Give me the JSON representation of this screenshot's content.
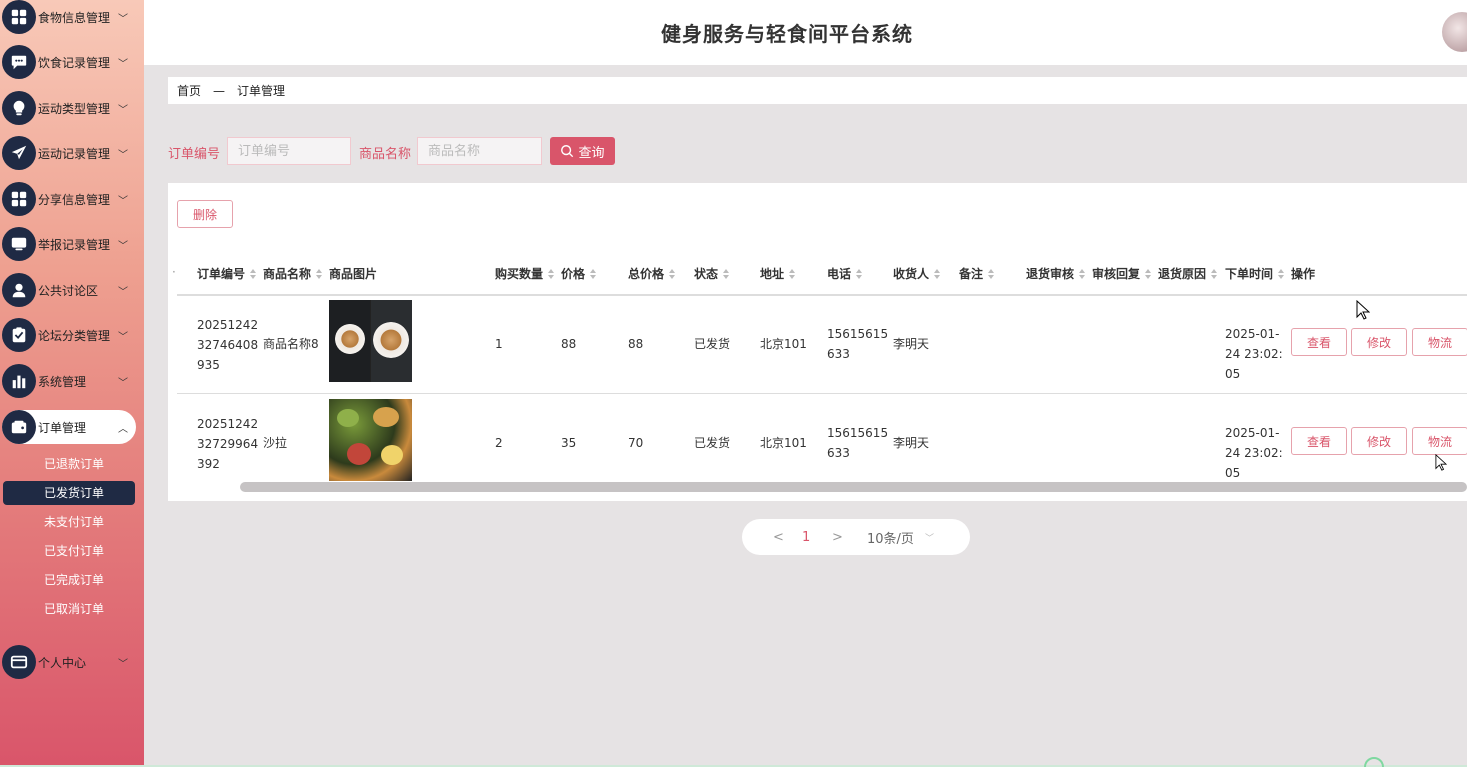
{
  "header": {
    "title": "健身服务与轻食间平台系统"
  },
  "sidebar": {
    "items": [
      {
        "label": "食物信息管理",
        "icon": "grid-icon"
      },
      {
        "label": "饮食记录管理",
        "icon": "chat-icon"
      },
      {
        "label": "运动类型管理",
        "icon": "bulb-icon"
      },
      {
        "label": "运动记录管理",
        "icon": "send-icon"
      },
      {
        "label": "分享信息管理",
        "icon": "grid-icon"
      },
      {
        "label": "举报记录管理",
        "icon": "monitor-icon"
      },
      {
        "label": "公共讨论区",
        "icon": "user-icon"
      },
      {
        "label": "论坛分类管理",
        "icon": "clipboard-icon"
      },
      {
        "label": "系统管理",
        "icon": "bar-chart-icon"
      },
      {
        "label": "订单管理",
        "icon": "wallet-icon"
      },
      {
        "label": "个人中心",
        "icon": "card-icon"
      }
    ],
    "order_sub": [
      "已退款订单",
      "已发货订单",
      "未支付订单",
      "已支付订单",
      "已完成订单",
      "已取消订单"
    ]
  },
  "breadcrumb": {
    "home": "首页",
    "sep": "—",
    "current": "订单管理"
  },
  "search": {
    "order_no_label": "订单编号",
    "order_no_placeholder": "订单编号",
    "product_label": "商品名称",
    "product_placeholder": "商品名称",
    "button": "查询"
  },
  "table": {
    "delete_button": "删除",
    "columns": [
      "订单编号",
      "商品名称",
      "商品图片",
      "购买数量",
      "价格",
      "总价格",
      "状态",
      "地址",
      "电话",
      "收货人",
      "备注",
      "退货审核",
      "审核回复",
      "退货原因",
      "下单时间",
      "操作"
    ],
    "rows": [
      {
        "order_no": "2025124232746408935",
        "product": "商品名称8",
        "qty": "1",
        "price": "88",
        "total": "88",
        "status": "已发货",
        "address": "北京101",
        "phone": "15615615633",
        "receiver": "李明天",
        "time": "2025-01-24 23:02:05"
      },
      {
        "order_no": "2025124232729964392",
        "product": "沙拉",
        "qty": "2",
        "price": "35",
        "total": "70",
        "status": "已发货",
        "address": "北京101",
        "phone": "15615615633",
        "receiver": "李明天",
        "time": "2025-01-24 23:02:05"
      }
    ],
    "actions": {
      "view": "查看",
      "edit": "修改",
      "logistics": "物流"
    }
  },
  "pager": {
    "prev": "<",
    "current": "1",
    "next": ">",
    "page_size": "10条/页"
  },
  "colors": {
    "accent": "#d9556a",
    "nav_dark": "#1f2a44"
  }
}
